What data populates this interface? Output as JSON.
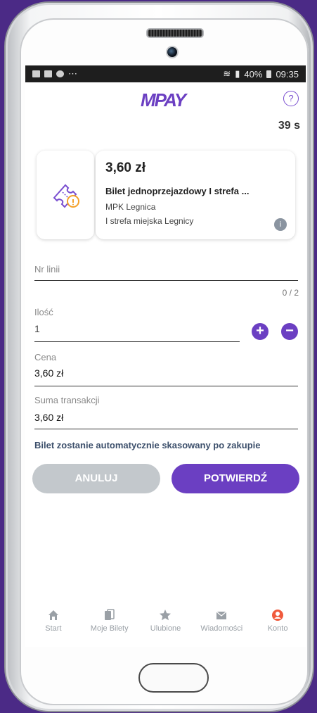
{
  "status_bar": {
    "left_text": "⋯",
    "battery": "40%",
    "time": "09:35"
  },
  "header": {
    "logo": "MPAY",
    "help_symbol": "?"
  },
  "timer": "39 s",
  "ticket": {
    "price": "3,60 zł",
    "name": "Bilet jednoprzejazdowy I strefa ...",
    "operator": "MPK Legnica",
    "zone": "I strefa miejska Legnicy",
    "info_symbol": "i"
  },
  "form": {
    "line_number": {
      "label": "Nr linii",
      "value": "",
      "counter": "0 / 2"
    },
    "quantity": {
      "label": "Ilość",
      "value": "1",
      "plus": "+",
      "minus": "−"
    },
    "price": {
      "label": "Cena",
      "value": "3,60 zł"
    },
    "total": {
      "label": "Suma transakcji",
      "value": "3,60 zł"
    },
    "notice": "Bilet zostanie automatycznie skasowany po zakupie"
  },
  "buttons": {
    "cancel": "ANULUJ",
    "confirm": "POTWIERDŹ"
  },
  "tabbar": {
    "items": [
      {
        "label": "Start",
        "icon": "home-icon"
      },
      {
        "label": "Moje Bilety",
        "icon": "tickets-icon"
      },
      {
        "label": "Ulubione",
        "icon": "star-icon"
      },
      {
        "label": "Wiadomości",
        "icon": "envelope-icon"
      },
      {
        "label": "Konto",
        "icon": "account-icon"
      }
    ]
  },
  "colors": {
    "accent": "#6b3fc2",
    "orange": "#f4a12a",
    "tab_inactive": "#9aa0a6",
    "account": "#f05a3c"
  }
}
